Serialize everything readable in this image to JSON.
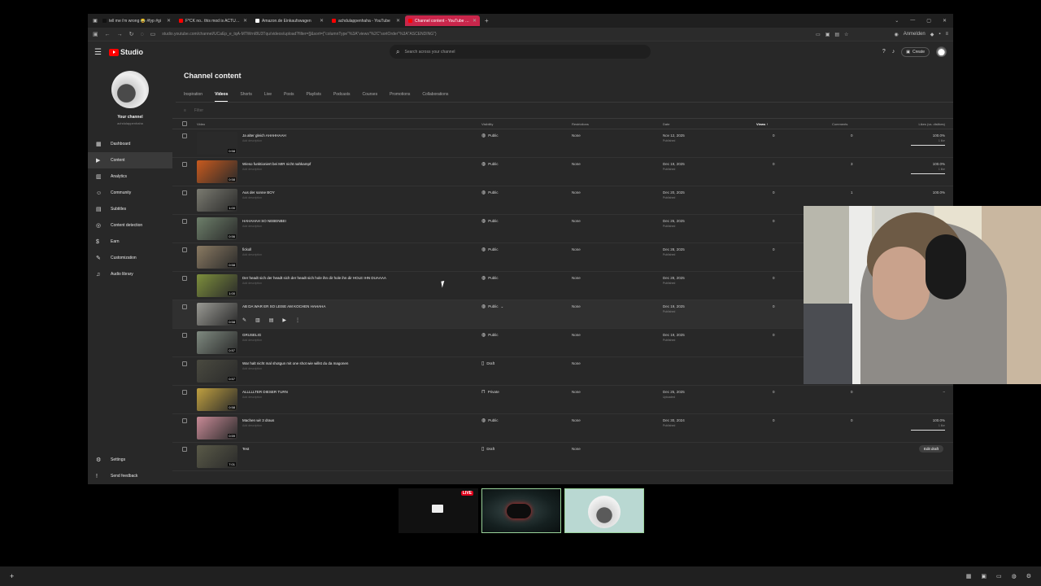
{
  "browser": {
    "tabs": [
      {
        "title": "tell me i'm wrong 😂 #fyp #gi",
        "color": "#111111",
        "active": false
      },
      {
        "title": "F*CK no.. this mod is ACTUALL",
        "color": "#ff0000",
        "active": false
      },
      {
        "title": "Amazon.de Einkaufswagen",
        "color": "#ffffff",
        "active": false
      },
      {
        "title": "achdulappenhaha - YouTube",
        "color": "#ff0000",
        "active": false
      },
      {
        "title": "Channel content - YouTube Stu",
        "color": "#ff0000",
        "active": true
      }
    ],
    "url": "studio.youtube.com/channel/UCaEp_e_tqA-MTWrnI8U3Tqu/videos/upload?filter=[]&sort={\"columnType\"%3A\"views\"%2C\"sortOrder\"%3A\"ASCENDING\"}",
    "translate_label": "Anmelden"
  },
  "studio": {
    "logo_text": "Studio",
    "search_placeholder": "Search across your channel",
    "create_label": "Create"
  },
  "sidebar": {
    "channel_name": "Your channel",
    "channel_handle": "achdulappenhaha",
    "items": [
      {
        "label": "Dashboard",
        "icon": "dashboard-icon",
        "glyph": "▦",
        "active": false
      },
      {
        "label": "Content",
        "icon": "content-icon",
        "glyph": "▶",
        "active": true
      },
      {
        "label": "Analytics",
        "icon": "analytics-icon",
        "glyph": "▥",
        "active": false
      },
      {
        "label": "Community",
        "icon": "community-icon",
        "glyph": "☺",
        "active": false
      },
      {
        "label": "Subtitles",
        "icon": "subtitles-icon",
        "glyph": "▤",
        "active": false
      },
      {
        "label": "Content detection",
        "icon": "content-detection-icon",
        "glyph": "◎",
        "active": false
      },
      {
        "label": "Earn",
        "icon": "earn-icon",
        "glyph": "$",
        "active": false
      },
      {
        "label": "Customization",
        "icon": "customization-icon",
        "glyph": "✎",
        "active": false
      },
      {
        "label": "Audio library",
        "icon": "audio-library-icon",
        "glyph": "♫",
        "active": false
      }
    ],
    "bottom_items": [
      {
        "label": "Settings",
        "icon": "settings-icon",
        "glyph": "⚙"
      },
      {
        "label": "Send feedback",
        "icon": "feedback-icon",
        "glyph": "!"
      }
    ]
  },
  "main": {
    "title": "Channel content",
    "tabs": [
      "Inspiration",
      "Videos",
      "Shorts",
      "Live",
      "Posts",
      "Playlists",
      "Podcasts",
      "Courses",
      "Promotions",
      "Collaborations"
    ],
    "active_tab": "Videos",
    "filter_placeholder": "Filter",
    "columns": {
      "video": "Video",
      "visibility": "Visibility",
      "restrictions": "Restrictions",
      "date": "Date",
      "views": "Views ↑",
      "comments": "Comments",
      "likes": "Likes (vs. dislikes)"
    },
    "rows": [
      {
        "title": "Ja alter gleich AHAHHAAH",
        "sub": "Add description",
        "duration": "0:58",
        "visibility": "Public",
        "vis_icon": "globe-icon",
        "restrictions": "None",
        "date": "Nov 12, 2025",
        "date_sub": "Published",
        "views": "0",
        "comments": "0",
        "likes": "100.0%",
        "likes_sub": "1 like",
        "thumb": "#2a2a2a"
      },
      {
        "title": "Wieso funktioniert bei MIR nicht nahkampf",
        "sub": "Add description",
        "duration": "0:58",
        "visibility": "Public",
        "vis_icon": "globe-icon",
        "restrictions": "None",
        "date": "Dec 19, 2025",
        "date_sub": "Published",
        "views": "0",
        "comments": "3",
        "likes": "100.0%",
        "likes_sub": "1 like",
        "thumb": "#c85a1e"
      },
      {
        "title": "Aus der sonne BOY",
        "sub": "Add description",
        "duration": "1:00",
        "visibility": "Public",
        "vis_icon": "globe-icon",
        "restrictions": "None",
        "date": "Dec 20, 2025",
        "date_sub": "Published",
        "views": "0",
        "comments": "1",
        "likes": "100.0%",
        "likes_sub": "",
        "thumb": "#7a7a70"
      },
      {
        "title": "HAHAHAH SO NEBENBEI",
        "sub": "Add description",
        "duration": "0:56",
        "visibility": "Public",
        "vis_icon": "globe-icon",
        "restrictions": "None",
        "date": "Dec 26, 2025",
        "date_sub": "Published",
        "views": "0",
        "comments": "",
        "likes": "",
        "likes_sub": "",
        "thumb": "#6d7f6a"
      },
      {
        "title": "fickoll",
        "sub": "Add description",
        "duration": "0:58",
        "visibility": "Public",
        "vis_icon": "globe-icon",
        "restrictions": "None",
        "date": "Dec 28, 2025",
        "date_sub": "Published",
        "views": "0",
        "comments": "",
        "likes": "",
        "likes_sub": "",
        "thumb": "#8a7a62"
      },
      {
        "title": "Der headt sich der headt sich der headt sich hole ihn dir hole ihn dir HOLE IHN DUAAAA",
        "sub": "Add description",
        "duration": "1:00",
        "visibility": "Public",
        "vis_icon": "globe-icon",
        "restrictions": "None",
        "date": "Dec 28, 2025",
        "date_sub": "Published",
        "views": "0",
        "comments": "",
        "likes": "",
        "likes_sub": "",
        "thumb": "#7d8f3c"
      },
      {
        "title": "AB DA WAR ER SO LEISE AM KOCHEN HAHAHA",
        "sub": "",
        "duration": "0:58",
        "visibility": "Public",
        "vis_icon": "globe-icon",
        "restrictions": "None",
        "date": "Dec 19, 2025",
        "date_sub": "Published",
        "views": "0",
        "comments": "",
        "likes": "",
        "likes_sub": "",
        "thumb": "#9a9a94",
        "hover": true
      },
      {
        "title": "GRUSELIG",
        "sub": "Add description",
        "duration": "0:57",
        "visibility": "Public",
        "vis_icon": "globe-icon",
        "restrictions": "None",
        "date": "Dec 19, 2025",
        "date_sub": "Published",
        "views": "0",
        "comments": "",
        "likes": "",
        "likes_sub": "",
        "thumb": "#7f8a80"
      },
      {
        "title": "War halt nicht mal shotgun mit one shot wie willst du da magonen",
        "sub": "Add description",
        "duration": "0:57",
        "visibility": "Draft",
        "vis_icon": "draft-icon",
        "restrictions": "None",
        "date": "",
        "date_sub": "",
        "views": "",
        "comments": "",
        "likes": "",
        "likes_sub": "",
        "thumb": "#4a4a40"
      },
      {
        "title": "ALLLLLTER DIESER TURN",
        "sub": "Add description",
        "duration": "0:58",
        "visibility": "Private",
        "vis_icon": "lock-icon",
        "restrictions": "None",
        "date": "Dec 25, 2025",
        "date_sub": "Uploaded",
        "views": "0",
        "comments": "0",
        "likes": "–",
        "likes_sub": "",
        "thumb": "#c0a040"
      },
      {
        "title": "Machen wir 3 draus",
        "sub": "Add description",
        "duration": "0:59",
        "visibility": "Public",
        "vis_icon": "globe-icon",
        "restrictions": "None",
        "date": "Dec 30, 2024",
        "date_sub": "Published",
        "views": "0",
        "comments": "0",
        "likes": "100.0%",
        "likes_sub": "1 like",
        "thumb": "#c88a96"
      },
      {
        "title": "Test",
        "sub": "",
        "duration": "7:01",
        "visibility": "Draft",
        "vis_icon": "draft-icon",
        "restrictions": "None",
        "date": "",
        "date_sub": "",
        "views": "",
        "comments": "",
        "likes": "",
        "likes_sub": "",
        "thumb": "#5a5a48",
        "edit_draft": "Edit draft"
      }
    ]
  },
  "taskbar": {
    "live_badge": "LIVE"
  }
}
